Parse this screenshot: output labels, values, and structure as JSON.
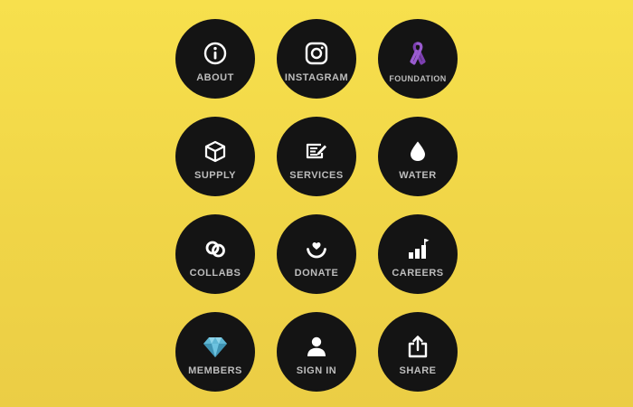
{
  "colors": {
    "background": "#f3d94a",
    "tile": "#141414",
    "label": "#bdbdbd",
    "icon": "#ffffff",
    "ribbon": "#7c3fb0",
    "gem": "#5fb7d4"
  },
  "tiles": [
    {
      "label": "ABOUT",
      "icon": "info-icon"
    },
    {
      "label": "INSTAGRAM",
      "icon": "instagram-icon"
    },
    {
      "label": "FOUNDATION",
      "icon": "ribbon-icon"
    },
    {
      "label": "SUPPLY",
      "icon": "box-icon"
    },
    {
      "label": "SERVICES",
      "icon": "edit-note-icon"
    },
    {
      "label": "WATER",
      "icon": "water-drop-icon"
    },
    {
      "label": "COLLABS",
      "icon": "rings-icon"
    },
    {
      "label": "DONATE",
      "icon": "heart-hand-icon"
    },
    {
      "label": "CAREERS",
      "icon": "growth-chart-icon"
    },
    {
      "label": "MEMBERS",
      "icon": "diamond-icon"
    },
    {
      "label": "SIGN IN",
      "icon": "user-icon"
    },
    {
      "label": "SHARE",
      "icon": "share-icon"
    }
  ]
}
